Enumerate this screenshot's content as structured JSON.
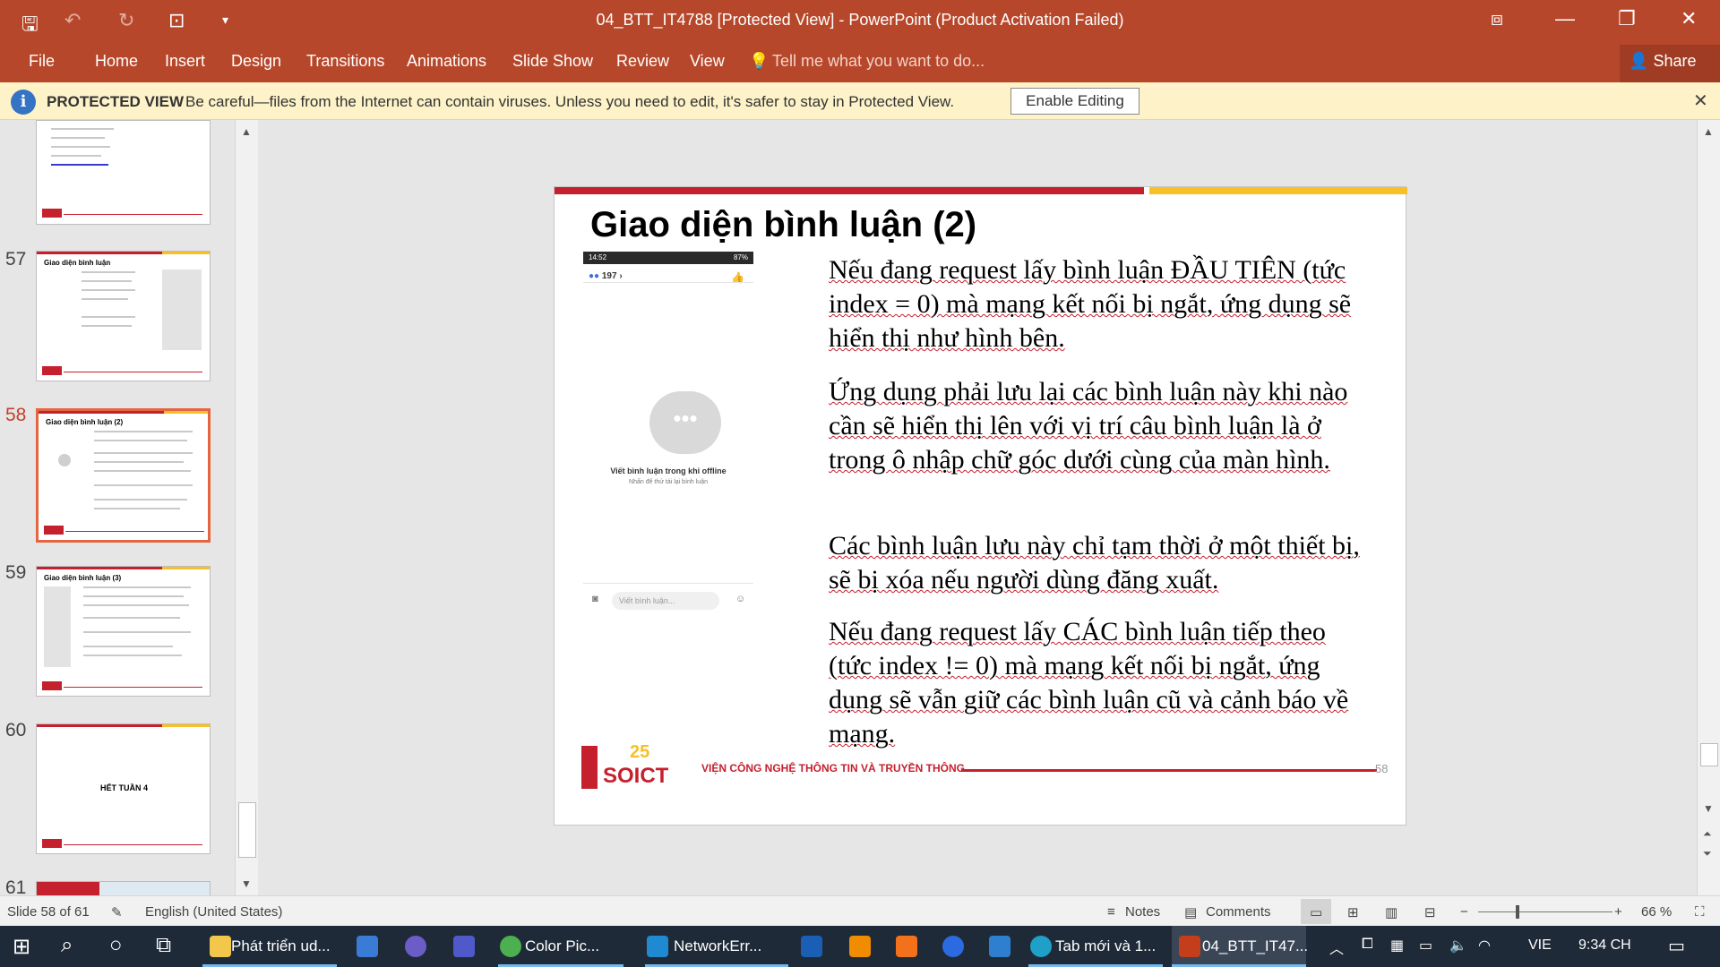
{
  "titlebar": {
    "title": "04_BTT_IT4788 [Protected View] - PowerPoint (Product Activation Failed)",
    "save_icon": "save-icon",
    "undo_icon": "undo-icon",
    "redo_icon": "redo-icon",
    "present_icon": "present-from-start-icon",
    "customize_icon": "customize-qat-icon"
  },
  "menu": {
    "items": [
      "File",
      "Home",
      "Insert",
      "Design",
      "Transitions",
      "Animations",
      "Slide Show",
      "Review",
      "View"
    ],
    "tell_me": "Tell me what you want to do...",
    "share": "Share"
  },
  "protected_view": {
    "title": "PROTECTED VIEW",
    "message": "Be careful—files from the Internet can contain viruses. Unless you need to edit, it's safer to stay in Protected View.",
    "enable_button": "Enable Editing"
  },
  "thumbnails": [
    {
      "number": "57",
      "title": "Giao diện bình luận"
    },
    {
      "number": "58",
      "title": "Giao diện bình luận (2)",
      "selected": true
    },
    {
      "number": "59",
      "title": "Giao diện bình luận (3)"
    },
    {
      "number": "60",
      "title": "",
      "center_text": "HẾT TUẦN 4"
    },
    {
      "number": "61",
      "title": ""
    }
  ],
  "slide": {
    "title": "Giao diện bình luận (2)",
    "paragraphs": [
      "Nếu đang request lấy bình luận ĐẦU TIÊN (tức index = 0) mà mạng kết nối bị ngắt, ứng dụng sẽ hiển thị như hình bên.",
      "Ứng dụng phải lưu lại các bình luận này khi nào cần sẽ hiển thị lên với vị trí câu bình luận là ở trong ô nhập chữ góc dưới cùng của màn hình.",
      "Các bình luận lưu này chỉ tạm thời ở một thiết bị, sẽ bị xóa nếu người dùng đăng xuất.",
      "Nếu đang request lấy CÁC bình luận tiếp theo (tức index != 0) mà mạng kết nối bị ngắt, ứng dụng sẽ vẫn giữ các bình luận cũ và cảnh báo về mạng."
    ],
    "phone": {
      "time": "14:52",
      "battery": "87%",
      "reactions": "197",
      "offline_title": "Viết bình luận trong khi offline",
      "offline_sub": "Nhấn để thử tải lại bình luận",
      "input_placeholder": "Viết bình luận..."
    },
    "footer_text": "VIỆN CÔNG NGHỆ THÔNG TIN VÀ TRUYỀN THÔNG",
    "logo_text": "SOICT",
    "logo_number": "25",
    "page_number": "58"
  },
  "statusbar": {
    "slide_info": "Slide 58 of 61",
    "language": "English (United States)",
    "notes": "Notes",
    "comments": "Comments",
    "zoom": "66 %"
  },
  "taskbar": {
    "apps": [
      "Phát triển ud...",
      "Color Pic...",
      "NetworkErr...",
      "Tab mới và 1...",
      "04_BTT_IT47..."
    ],
    "language": "VIE",
    "time": "9:34 CH"
  },
  "colors": {
    "ppt_accent": "#b7472a",
    "slide_red": "#c5202e",
    "slide_yellow": "#f6c026",
    "protected_bar": "#fdf2c8",
    "taskbar": "#1f2a38"
  }
}
